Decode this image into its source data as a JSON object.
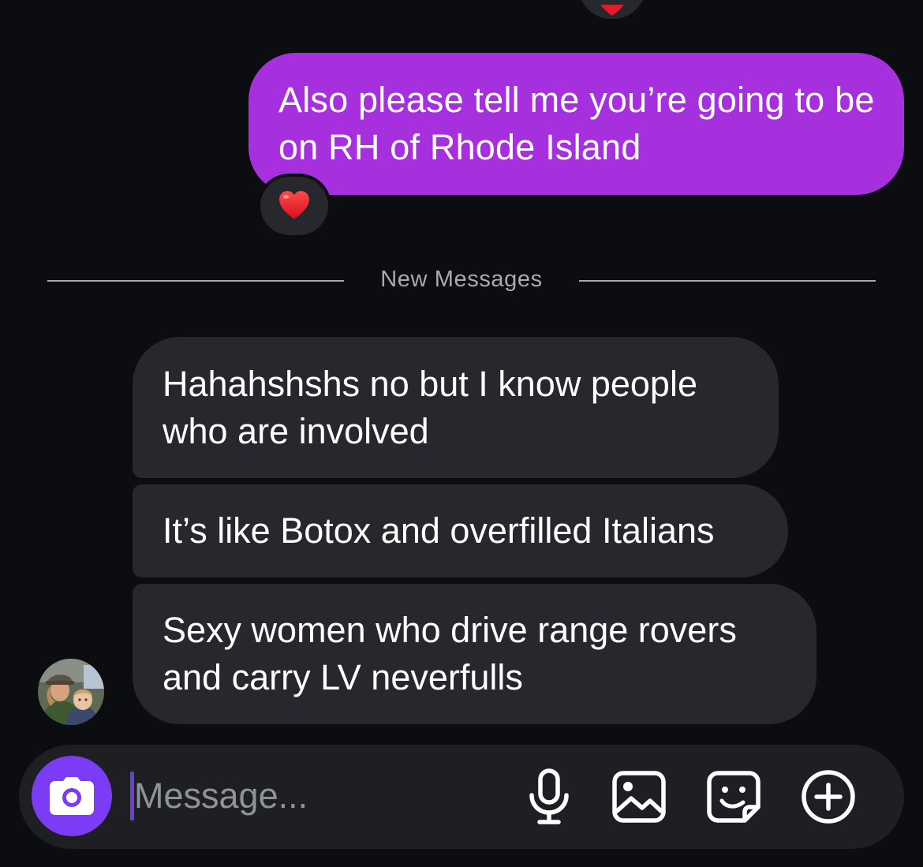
{
  "colors": {
    "background": "#0c0d10",
    "sent_bubble": "#a730de",
    "received_bubble": "#26282d",
    "camera_button": "#7c3bf5",
    "divider": "#a7abb2",
    "heart": "#e8192c"
  },
  "conversation": {
    "previous_reaction_emoji": "heart-icon",
    "sent_message": {
      "text": "Also please tell me you’re going to be on RH of Rhode Island",
      "reaction_emoji": "heart-icon"
    },
    "divider_label": "New Messages",
    "received_messages": [
      {
        "text": "Hahahshshs no but I know people who are involved"
      },
      {
        "text": "It’s like Botox and overfilled Italians"
      },
      {
        "text": "Sexy women who drive range rovers and carry LV neverfulls"
      }
    ]
  },
  "composer": {
    "placeholder": "Message...",
    "value": "",
    "icons": [
      "camera-icon",
      "microphone-icon",
      "gallery-icon",
      "sticker-icon",
      "plus-circle-icon"
    ]
  }
}
